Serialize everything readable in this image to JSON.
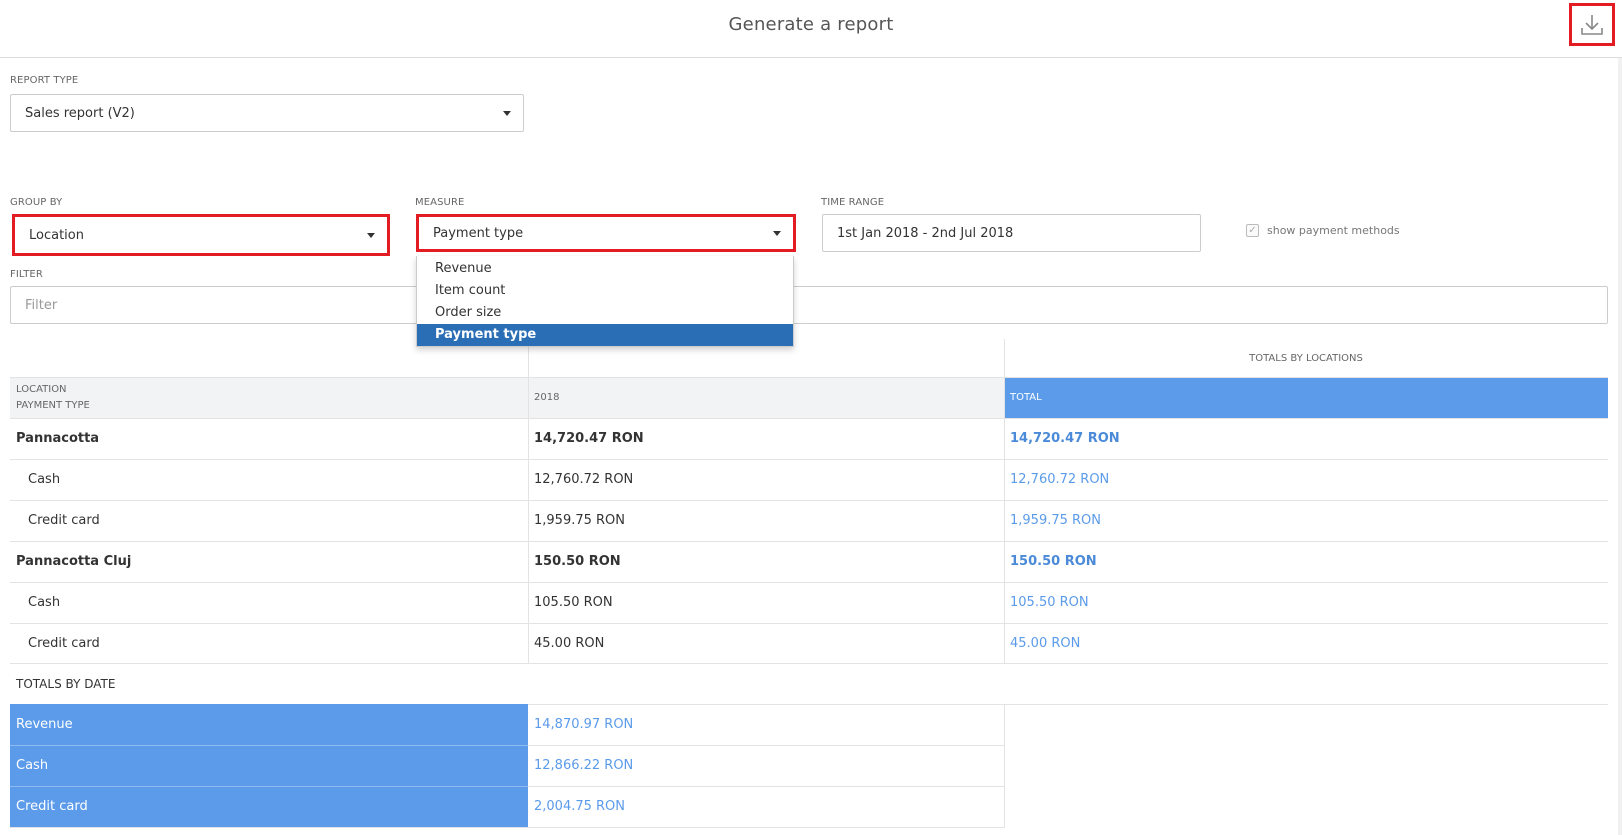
{
  "header": {
    "title": "Generate a report",
    "download_icon": "download-icon"
  },
  "report_type": {
    "label": "REPORT TYPE",
    "value": "Sales report (V2)"
  },
  "group_by": {
    "label": "GROUP BY",
    "value": "Location"
  },
  "measure": {
    "label": "MEASURE",
    "value": "Payment type",
    "options": [
      "Revenue",
      "Item count",
      "Order size",
      "Payment type"
    ],
    "selected_option": "Payment type"
  },
  "time_range": {
    "label": "TIME RANGE",
    "value": "1st Jan  2018 - 2nd Jul  2018"
  },
  "show_payment_methods": {
    "label": "show payment methods",
    "checked": true
  },
  "filter": {
    "label": "FILTER",
    "placeholder": "Filter"
  },
  "table": {
    "totals_by_locations_label": "TOTALS BY LOCATIONS",
    "row_header_1": "LOCATION",
    "row_header_2": "PAYMENT TYPE",
    "year_header": "2018",
    "total_header": "TOTAL",
    "rows": [
      {
        "name": "Pannacotta",
        "value": "14,720.47 RON",
        "total": "14,720.47 RON",
        "group": true
      },
      {
        "name": "Cash",
        "value": "12,760.72 RON",
        "total": "12,760.72 RON",
        "group": false
      },
      {
        "name": "Credit card",
        "value": "1,959.75 RON",
        "total": "1,959.75 RON",
        "group": false
      },
      {
        "name": "Pannacotta Cluj",
        "value": "150.50 RON",
        "total": "150.50 RON",
        "group": true
      },
      {
        "name": "Cash",
        "value": "105.50 RON",
        "total": "105.50 RON",
        "group": false
      },
      {
        "name": "Credit card",
        "value": "45.00 RON",
        "total": "45.00 RON",
        "group": false
      }
    ],
    "totals_by_date_label": "TOTALS BY DATE",
    "date_totals": [
      {
        "name": "Revenue",
        "value": "14,870.97 RON"
      },
      {
        "name": "Cash",
        "value": "12,866.22 RON"
      },
      {
        "name": "Credit card",
        "value": "2,004.75 RON"
      }
    ]
  },
  "colors": {
    "highlight_red": "#e31b23",
    "accent_blue": "#5b9bea",
    "selected_blue": "#2a6fb6"
  }
}
